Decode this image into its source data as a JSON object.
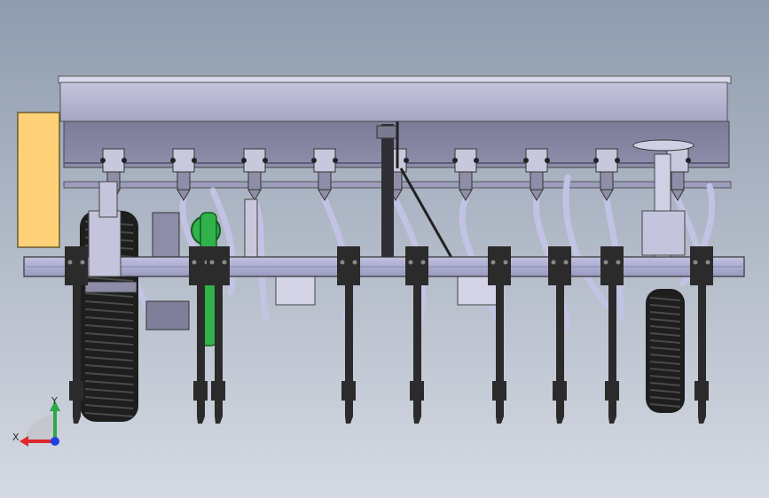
{
  "view": {
    "background_top": "#8f9cae",
    "background_bottom": "#d5d9e2",
    "body_color": "#b8b8d4",
    "body_dark": "#8a8aa8",
    "bar_color": "#a5a5cc",
    "shank_color": "#2b2b2b",
    "hose_color": "#c9c9ea",
    "motor_color": "#ffd27a",
    "sprocket_color": "#2fb34a",
    "tire_color": "#1e1e1e"
  },
  "axis_triad": {
    "x_label": "X",
    "y_label": "Y",
    "x_color": "#e0262b",
    "y_color": "#2fa84a",
    "z_color": "#2040e0"
  }
}
